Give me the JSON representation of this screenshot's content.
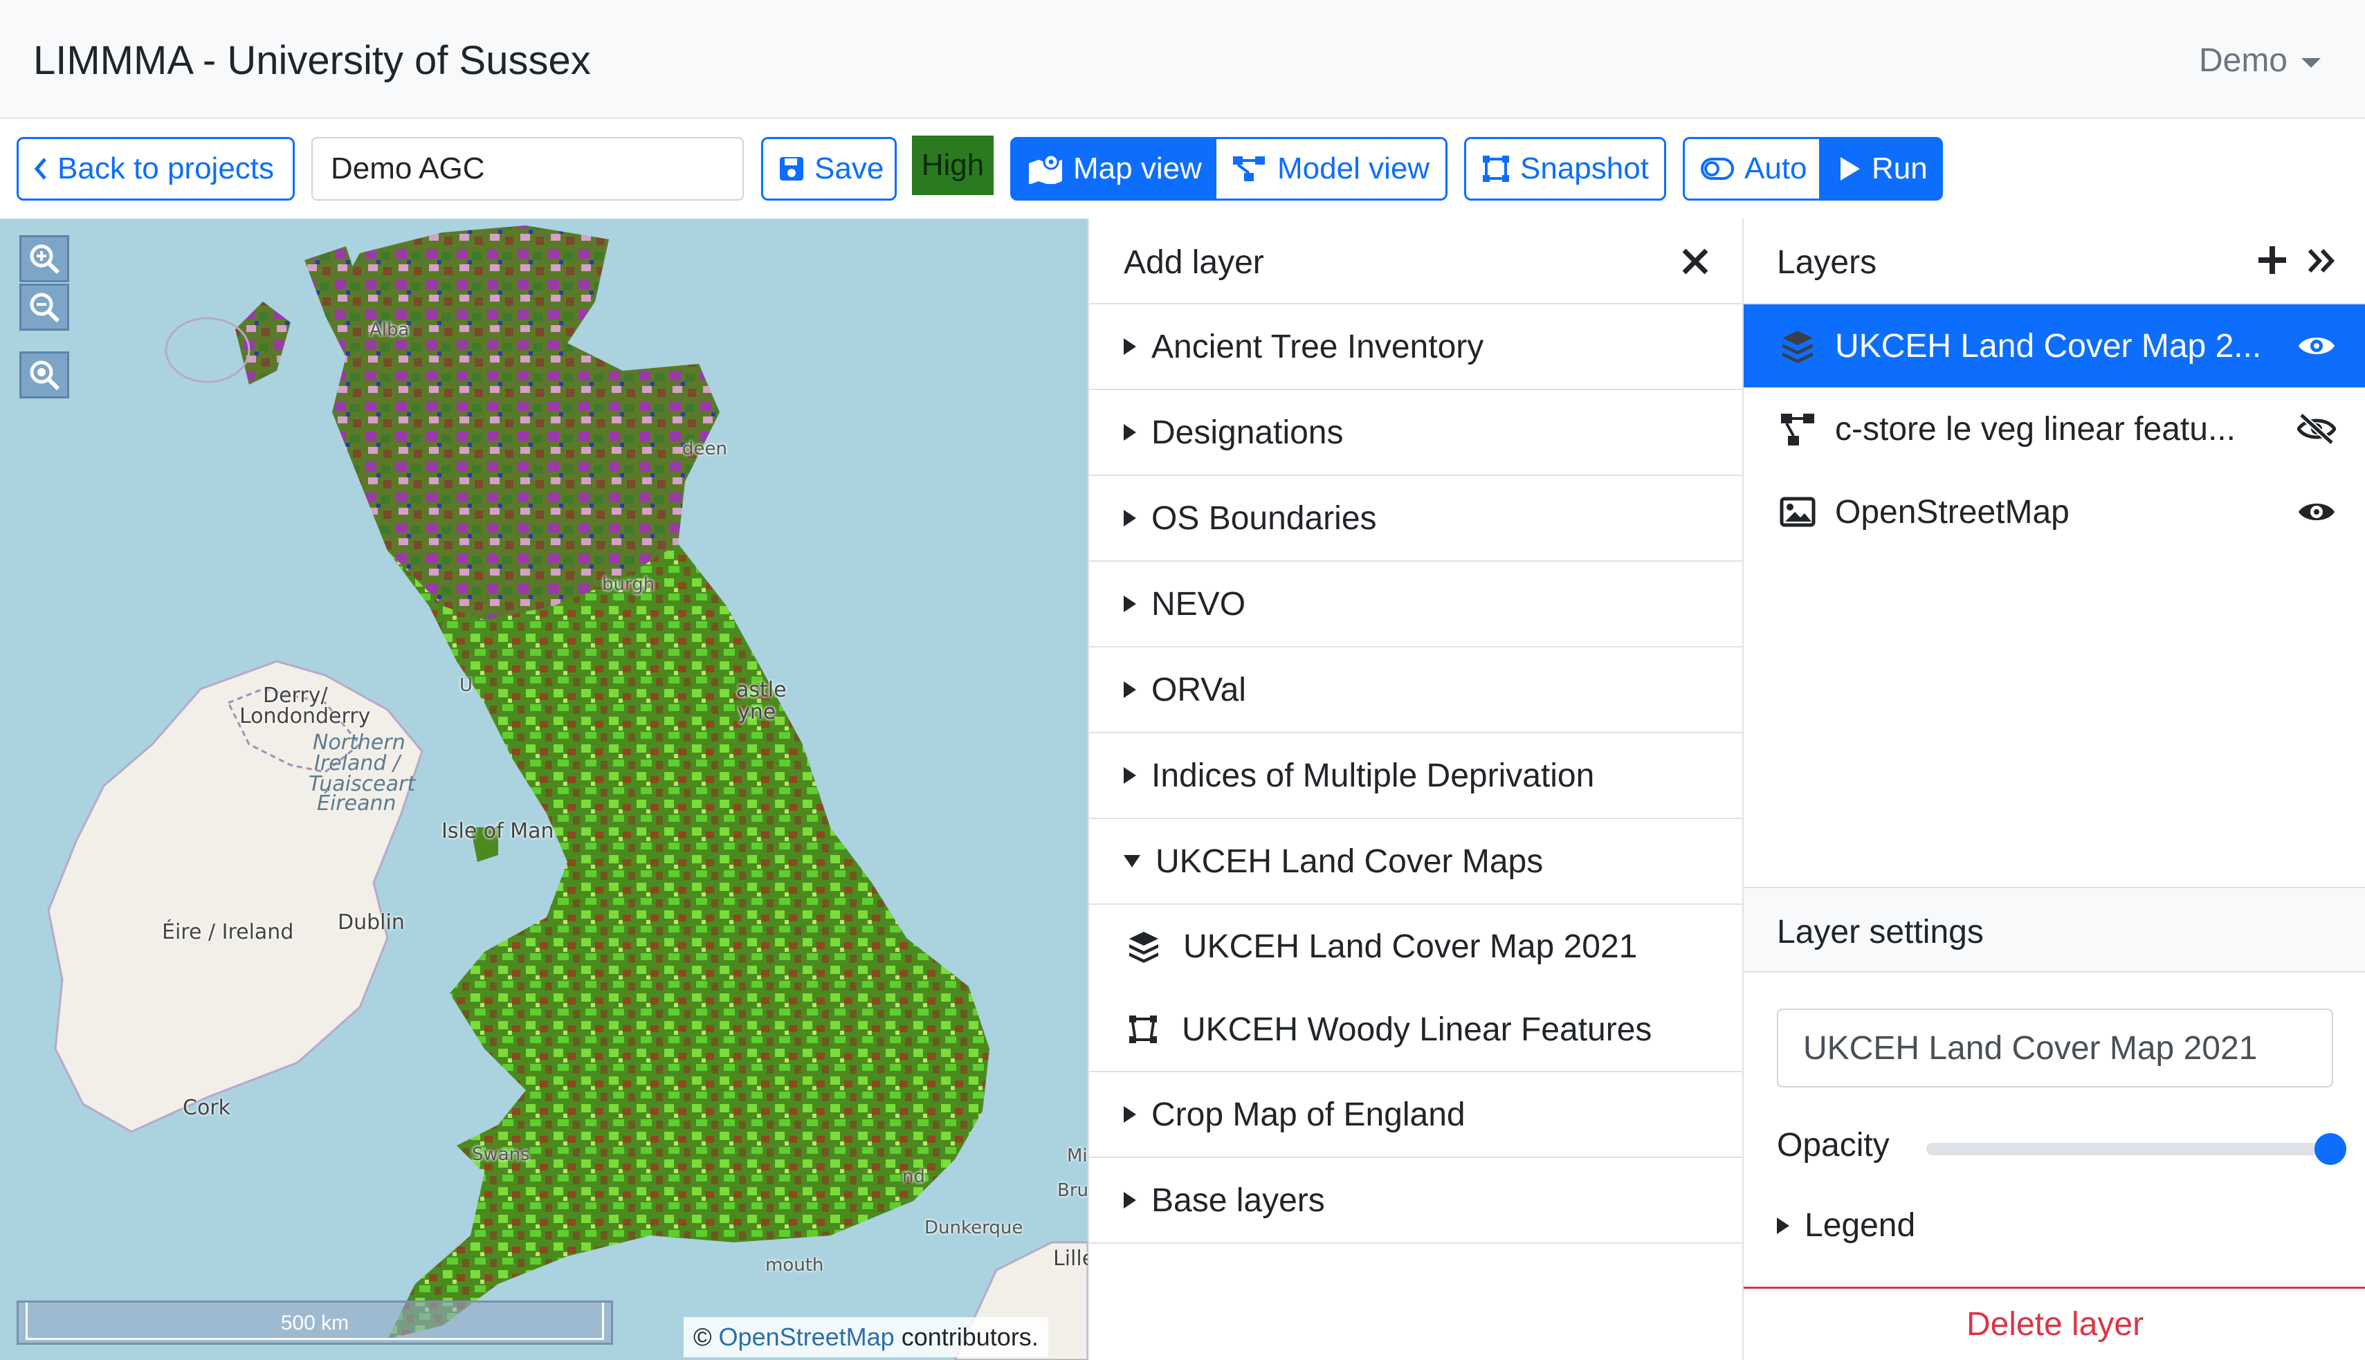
{
  "app": {
    "title": "LIMMMA - University of Sussex",
    "user_menu": "Demo"
  },
  "toolbar": {
    "back_label": "Back to projects",
    "project_name": "Demo AGC",
    "save_label": "Save",
    "quality_badge": "High",
    "map_view_label": "Map view",
    "model_view_label": "Model view",
    "snapshot_label": "Snapshot",
    "auto_label": "Auto",
    "run_label": "Run"
  },
  "map": {
    "scale_label": "500 km",
    "attribution_prefix": "©",
    "attribution_link": "OpenStreetMap",
    "attribution_suffix": "contributors.",
    "places": {
      "alba": "Alba",
      "deen": "deen",
      "burgh": "burgh",
      "derry_1": "Derry/",
      "derry_2": "Londonderry",
      "ni_1": "Northern",
      "ni_2": "Ireland /",
      "ni_3": "Tuaisceart",
      "ni_4": "Éireann",
      "isle_of_man": "Isle of Man",
      "dublin": "Dublin",
      "eire": "Éire / Ireland",
      "cork": "Cork",
      "castle": "astle",
      "tyne": "yne",
      "swans": "Swans",
      "mouth": "mouth",
      "dunkerque": "Dunkerque",
      "lille": "Lille",
      "bru": "Bru",
      "mi": "Mi",
      "u": "U",
      "nd": "nd"
    }
  },
  "add_layer": {
    "title": "Add layer",
    "categories": [
      {
        "label": "Ancient Tree Inventory",
        "expanded": false
      },
      {
        "label": "Designations",
        "expanded": false
      },
      {
        "label": "OS Boundaries",
        "expanded": false
      },
      {
        "label": "NEVO",
        "expanded": false
      },
      {
        "label": "ORVal",
        "expanded": false
      },
      {
        "label": "Indices of Multiple Deprivation",
        "expanded": false
      },
      {
        "label": "UKCEH Land Cover Maps",
        "expanded": true,
        "items": [
          {
            "label": "UKCEH Land Cover Map 2021",
            "icon": "layers-icon"
          },
          {
            "label": "UKCEH Woody Linear Features",
            "icon": "vector-shape-icon"
          }
        ]
      },
      {
        "label": "Crop Map of England",
        "expanded": false
      },
      {
        "label": "Base layers",
        "expanded": false
      }
    ]
  },
  "layers": {
    "title": "Layers",
    "items": [
      {
        "label": "UKCEH Land Cover Map 2...",
        "icon": "layers-icon",
        "visible": true,
        "active": true
      },
      {
        "label": "c-store le veg linear featu...",
        "icon": "model-graph-icon",
        "visible": false,
        "active": false
      },
      {
        "label": "OpenStreetMap",
        "icon": "image-icon",
        "visible": true,
        "active": false
      }
    ]
  },
  "layer_settings": {
    "title": "Layer settings",
    "name_value": "UKCEH Land Cover Map 2021",
    "opacity_label": "Opacity",
    "opacity_value": 1.0,
    "legend_label": "Legend",
    "delete_label": "Delete layer"
  },
  "colors": {
    "primary": "#0d6efd",
    "danger": "#dc3545",
    "badge_high": "#2b7a20",
    "sea": "#aad3df"
  }
}
